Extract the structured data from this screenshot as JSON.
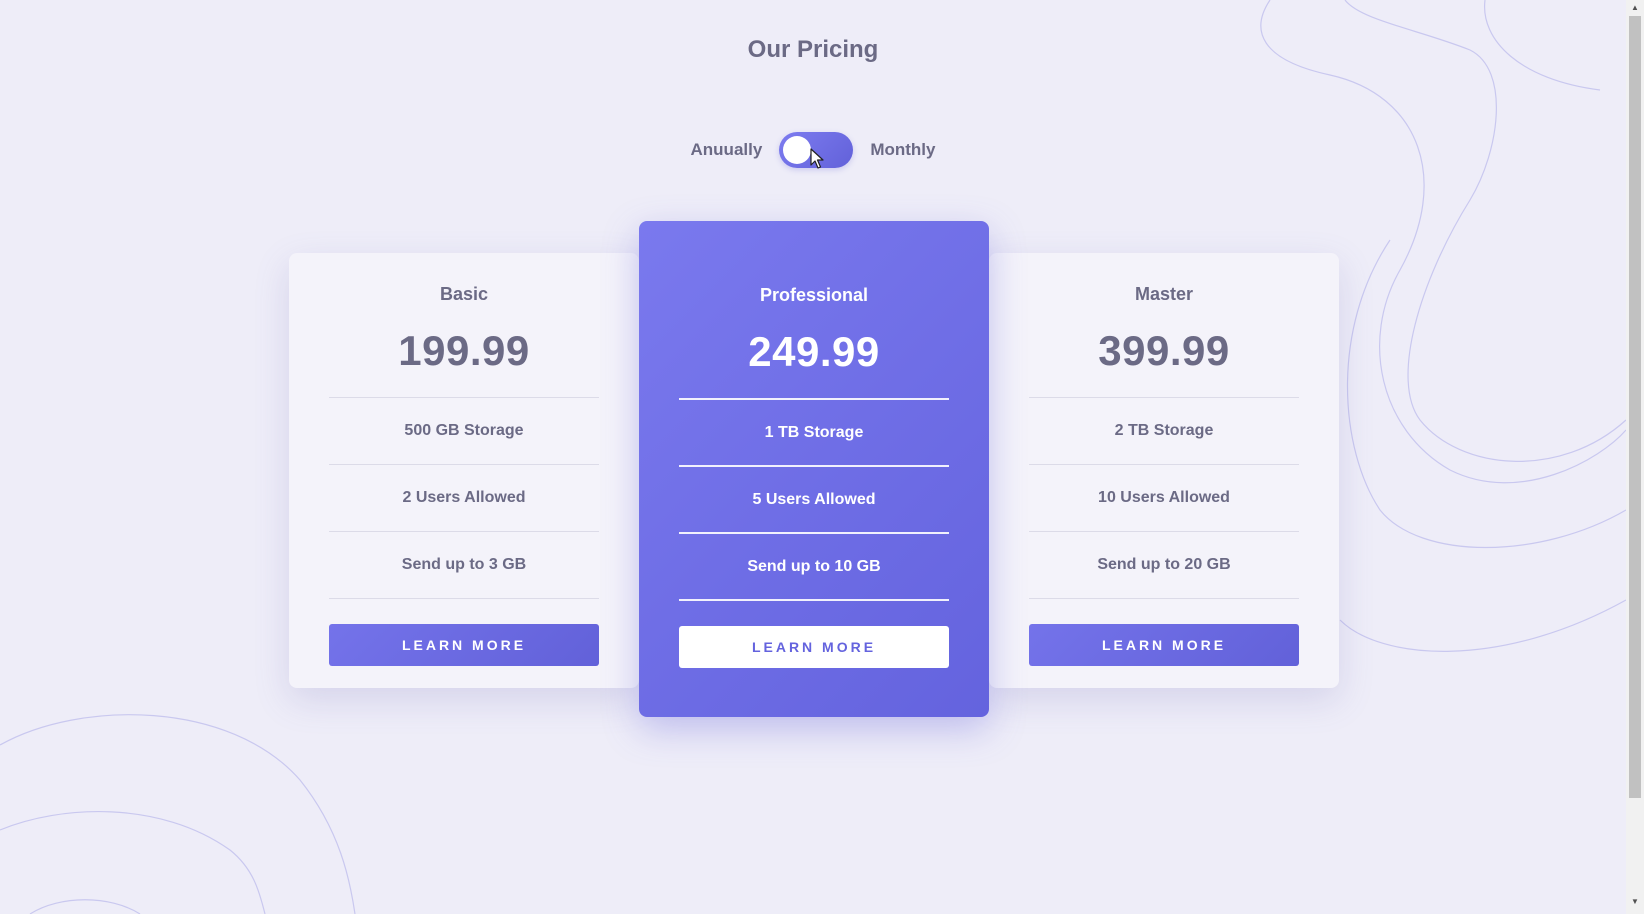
{
  "page": {
    "title": "Our Pricing"
  },
  "billing_toggle": {
    "left_label": "Anuually",
    "right_label": "Monthly"
  },
  "plans": [
    {
      "name": "Basic",
      "price": "199.99",
      "features": [
        "500 GB Storage",
        "2 Users Allowed",
        "Send up to 3 GB"
      ],
      "button_label": "LEARN MORE"
    },
    {
      "name": "Professional",
      "price": "249.99",
      "features": [
        "1 TB Storage",
        "5 Users Allowed",
        "Send up to 10 GB"
      ],
      "button_label": "LEARN MORE"
    },
    {
      "name": "Master",
      "price": "399.99",
      "features": [
        "2 TB Storage",
        "10 Users Allowed",
        "Send up to 20 GB"
      ],
      "button_label": "LEARN MORE"
    }
  ],
  "colors": {
    "background": "#eeedf8",
    "accent": "#6a69e2",
    "text": "#6b6a85",
    "card": "#f4f3fa"
  },
  "icons": {
    "cursor": "mouse-pointer-icon",
    "scroll_up": "scroll-up-arrow-icon",
    "scroll_down": "scroll-down-arrow-icon"
  }
}
